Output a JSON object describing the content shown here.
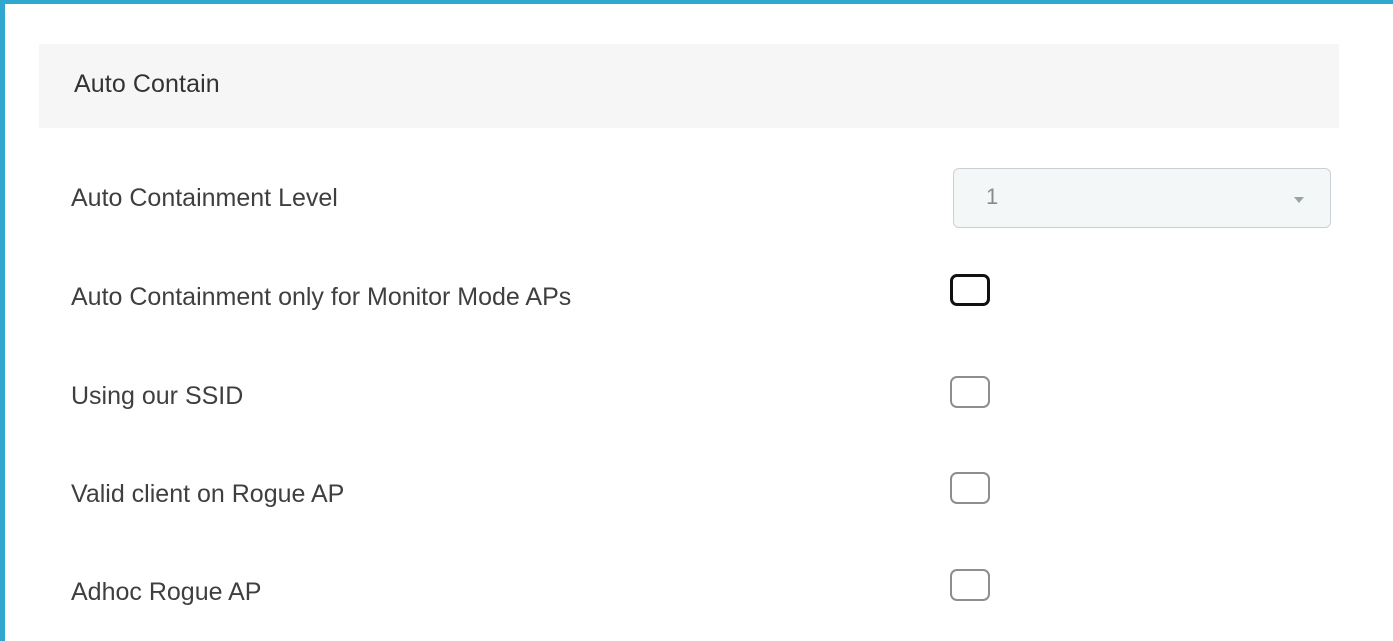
{
  "section": {
    "title": "Auto Contain"
  },
  "containment_level": {
    "label": "Auto Containment Level",
    "value": "1"
  },
  "options": [
    {
      "label": "Auto Containment only for Monitor Mode APs",
      "checked": false
    },
    {
      "label": "Using our SSID",
      "checked": false
    },
    {
      "label": "Valid client on Rogue AP",
      "checked": false
    },
    {
      "label": "Adhoc Rogue AP",
      "checked": false
    }
  ],
  "colors": {
    "frame_accent": "#2fa7cf",
    "header_background": "#f6f6f6"
  },
  "icons": {
    "select_caret": "chevron-down-icon"
  }
}
